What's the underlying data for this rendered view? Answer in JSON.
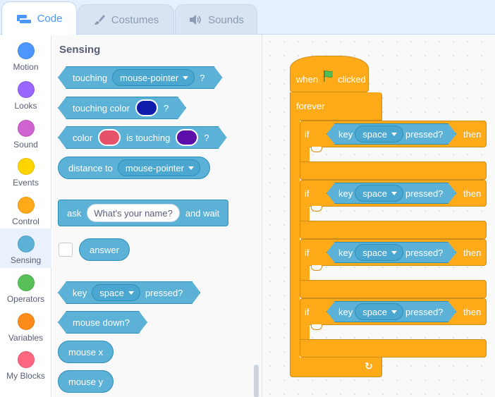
{
  "tabs": [
    {
      "label": "Code",
      "icon": "code-icon",
      "active": true
    },
    {
      "label": "Costumes",
      "icon": "brush-icon",
      "active": false
    },
    {
      "label": "Sounds",
      "icon": "speaker-icon",
      "active": false
    }
  ],
  "categories": [
    {
      "label": "Motion",
      "color": "#4c97ff"
    },
    {
      "label": "Looks",
      "color": "#9966ff"
    },
    {
      "label": "Sound",
      "color": "#cf63cf"
    },
    {
      "label": "Events",
      "color": "#ffd500"
    },
    {
      "label": "Control",
      "color": "#ffab19"
    },
    {
      "label": "Sensing",
      "color": "#5cb1d6",
      "selected": true
    },
    {
      "label": "Operators",
      "color": "#59c059"
    },
    {
      "label": "Variables",
      "color": "#ff8c1a"
    },
    {
      "label": "My Blocks",
      "color": "#ff6680"
    }
  ],
  "palette": {
    "section_title": "Sensing",
    "touching": {
      "label": "touching",
      "menu": "mouse-pointer",
      "suffix": "?"
    },
    "touching_color": {
      "label": "touching color",
      "swatch": "#0f1bab",
      "suffix": "?"
    },
    "color_touching": {
      "label": "color",
      "swatch1": "#e6526a",
      "mid": "is touching",
      "swatch2": "#5b0fa8",
      "suffix": "?"
    },
    "distance_to": {
      "label": "distance to",
      "menu": "mouse-pointer"
    },
    "ask": {
      "label": "ask",
      "input": "What's your name?",
      "suffix": "and wait"
    },
    "answer": {
      "label": "answer"
    },
    "key_pressed": {
      "label": "key",
      "menu": "space",
      "suffix": "pressed?"
    },
    "mouse_down": {
      "label": "mouse down?"
    },
    "mouse_x": {
      "label": "mouse x"
    },
    "mouse_y": {
      "label": "mouse y"
    }
  },
  "script": {
    "hat": {
      "prefix": "when",
      "flag_icon": "green-flag-icon",
      "suffix": "clicked"
    },
    "forever": {
      "label": "forever"
    },
    "ifs": [
      {
        "if": "if",
        "key": "key",
        "menu": "space",
        "pressed": "pressed?",
        "then": "then"
      },
      {
        "if": "if",
        "key": "key",
        "menu": "space",
        "pressed": "pressed?",
        "then": "then"
      },
      {
        "if": "if",
        "key": "key",
        "menu": "space",
        "pressed": "pressed?",
        "then": "then"
      },
      {
        "if": "if",
        "key": "key",
        "menu": "space",
        "pressed": "pressed?",
        "then": "then"
      }
    ]
  }
}
